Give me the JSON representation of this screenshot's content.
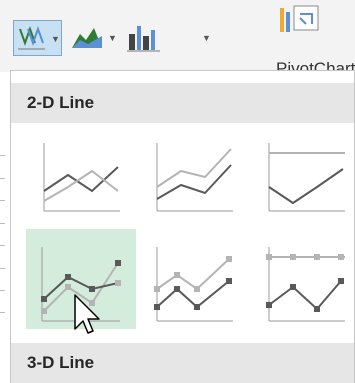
{
  "ribbon": {
    "pivot_chart_label": "PivotChart"
  },
  "gallery": {
    "section_2d_title": "2-D Line",
    "section_3d_title": "3-D Line",
    "items_2d": [
      {
        "name": "line"
      },
      {
        "name": "stacked-line"
      },
      {
        "name": "100-stacked-line"
      },
      {
        "name": "line-with-markers",
        "hovered": true
      },
      {
        "name": "stacked-line-with-markers"
      },
      {
        "name": "100-stacked-line-with-markers"
      }
    ]
  },
  "colors": {
    "accent_hover": "#d4ecdb",
    "ribbon_selected": "#c7e0f4",
    "section_bg": "#e6e6e6",
    "dark_series": "#595959",
    "light_series": "#b4b4b4"
  }
}
